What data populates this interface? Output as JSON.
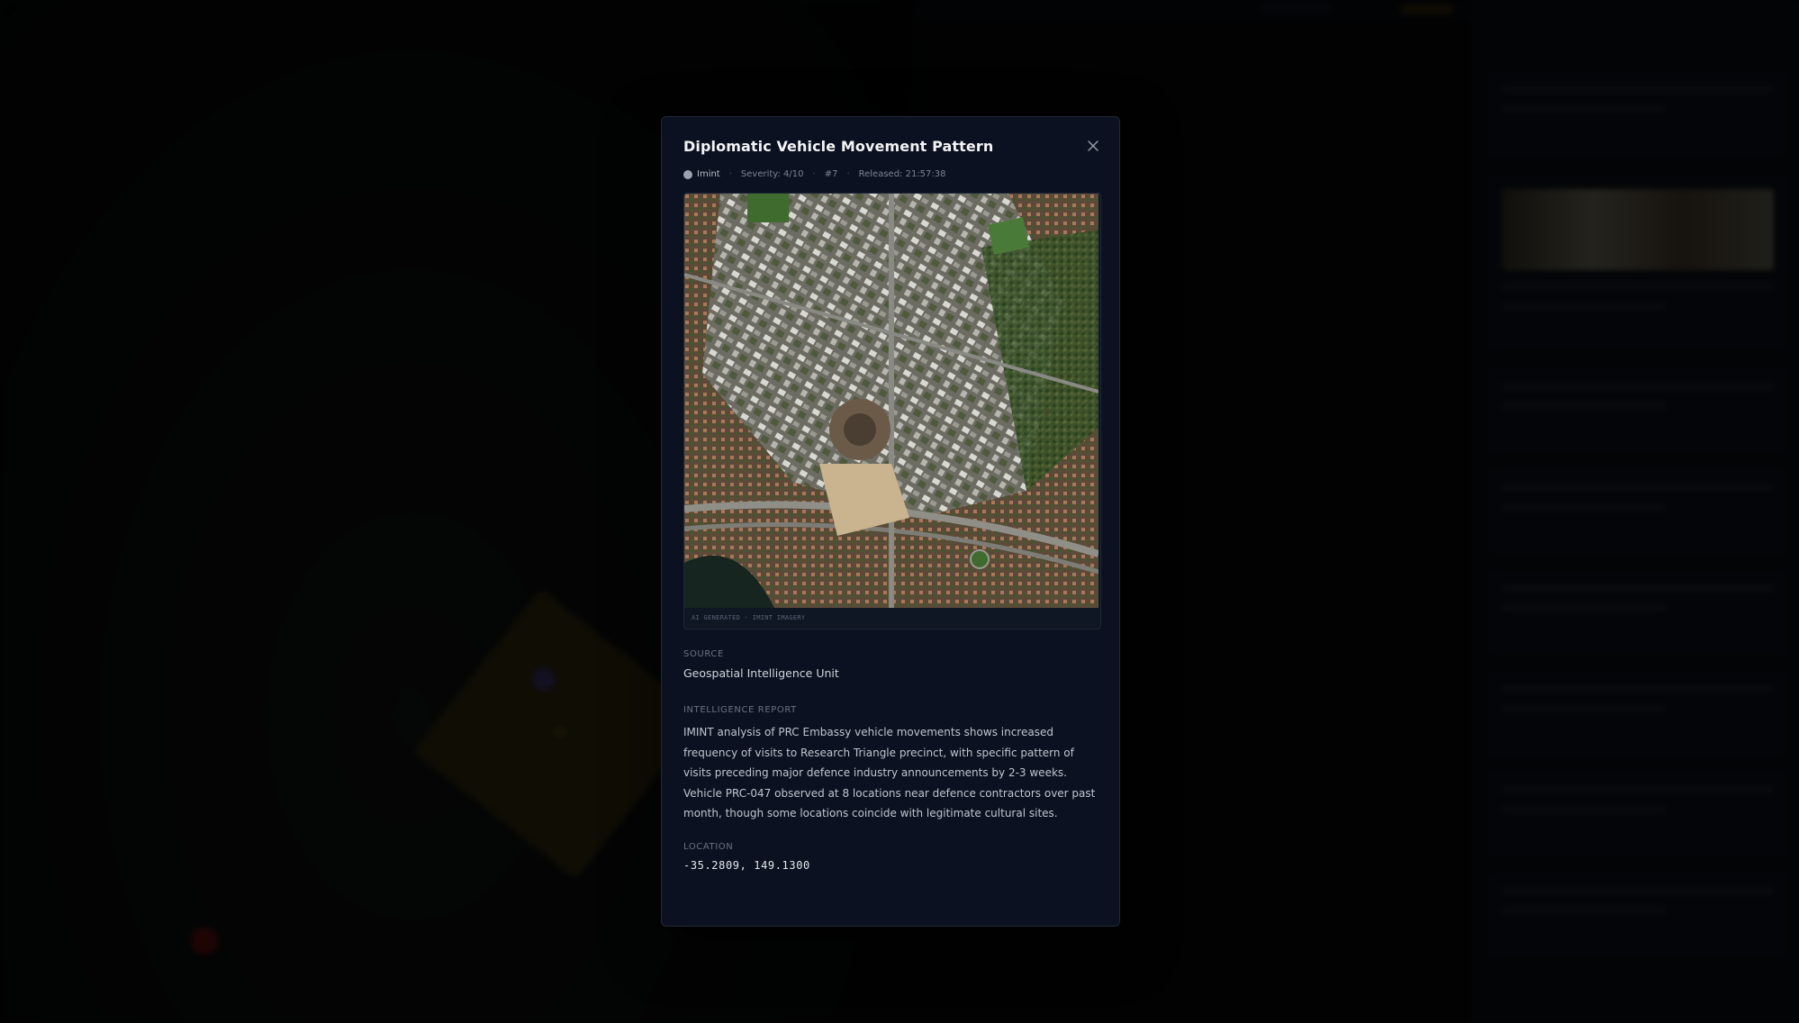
{
  "modal": {
    "title": "Diplomatic Vehicle Movement Pattern",
    "meta": {
      "type": "Imint",
      "severity": "Severity: 4/10",
      "number": "#7",
      "released": "Released: 21:57:38"
    },
    "image": {
      "caption": "AI GENERATED · IMINT IMAGERY"
    },
    "source": {
      "label": "SOURCE",
      "value": "Geospatial Intelligence Unit"
    },
    "report": {
      "label": "INTELLIGENCE REPORT",
      "text": "IMINT analysis of PRC Embassy vehicle movements shows increased frequency of visits to Research Triangle precinct, with specific pattern of visits preceding major defence industry announcements by 2-3 weeks. Vehicle PRC-047 observed at 8 locations near defence contractors over past month, though some locations coincide with legitimate cultural sites."
    },
    "location": {
      "label": "LOCATION",
      "value": "-35.2809, 149.1300"
    }
  },
  "colors": {
    "modal_bg": "#0b1120",
    "border": "#1f2937",
    "type_dot": "#9ca3af"
  },
  "icons": {
    "close": "close-icon",
    "type": "circle-dot-icon"
  }
}
